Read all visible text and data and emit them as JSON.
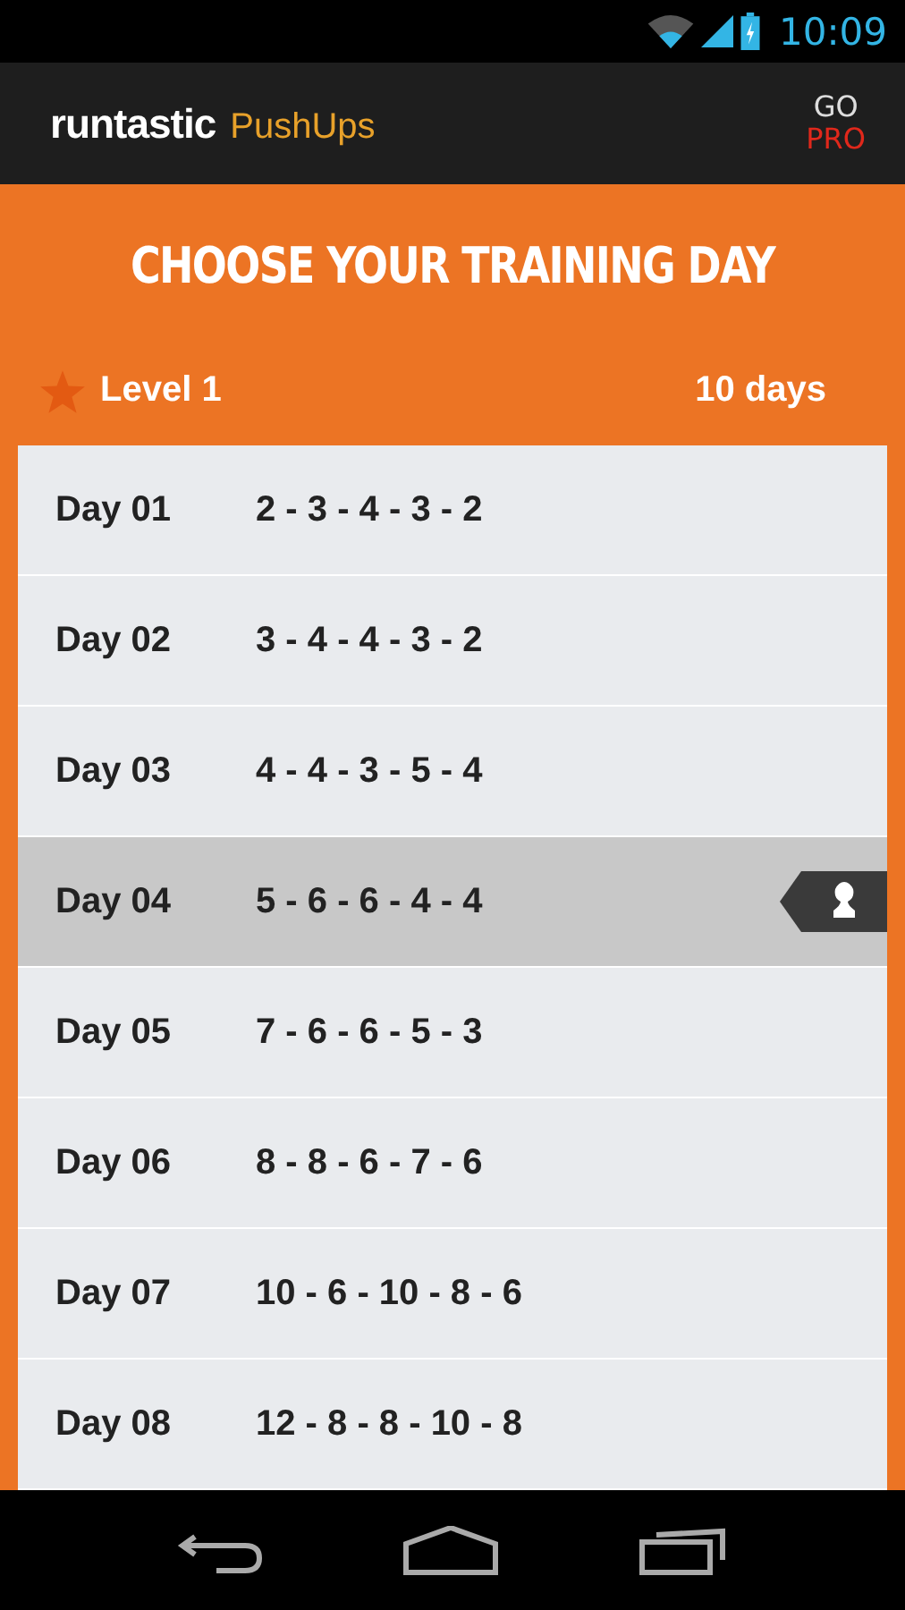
{
  "status_bar": {
    "time": "10:09"
  },
  "app_bar": {
    "brand": "runtastic",
    "product": "PushUps",
    "go_pro": {
      "top": "GO",
      "bottom": "PRO"
    }
  },
  "title": "CHOOSE YOUR TRAINING DAY",
  "level": {
    "label": "Level 1",
    "days": "10 days"
  },
  "days": [
    {
      "day": "Day 01",
      "sets": "2 - 3 - 4 - 3 - 2",
      "selected": false
    },
    {
      "day": "Day 02",
      "sets": "3 - 4 - 4 - 3 - 2",
      "selected": false
    },
    {
      "day": "Day 03",
      "sets": "4 - 4 - 3 - 5 - 4",
      "selected": false
    },
    {
      "day": "Day 04",
      "sets": "5 - 6 - 6 - 4 - 4",
      "selected": true
    },
    {
      "day": "Day 05",
      "sets": "7 - 6 - 6 - 5 - 3",
      "selected": false
    },
    {
      "day": "Day 06",
      "sets": "8 - 8 - 6 - 7 - 6",
      "selected": false
    },
    {
      "day": "Day 07",
      "sets": "10 - 6 - 10 - 8 - 6",
      "selected": false
    },
    {
      "day": "Day 08",
      "sets": "12 - 8 - 8 - 10 - 8",
      "selected": false
    }
  ]
}
